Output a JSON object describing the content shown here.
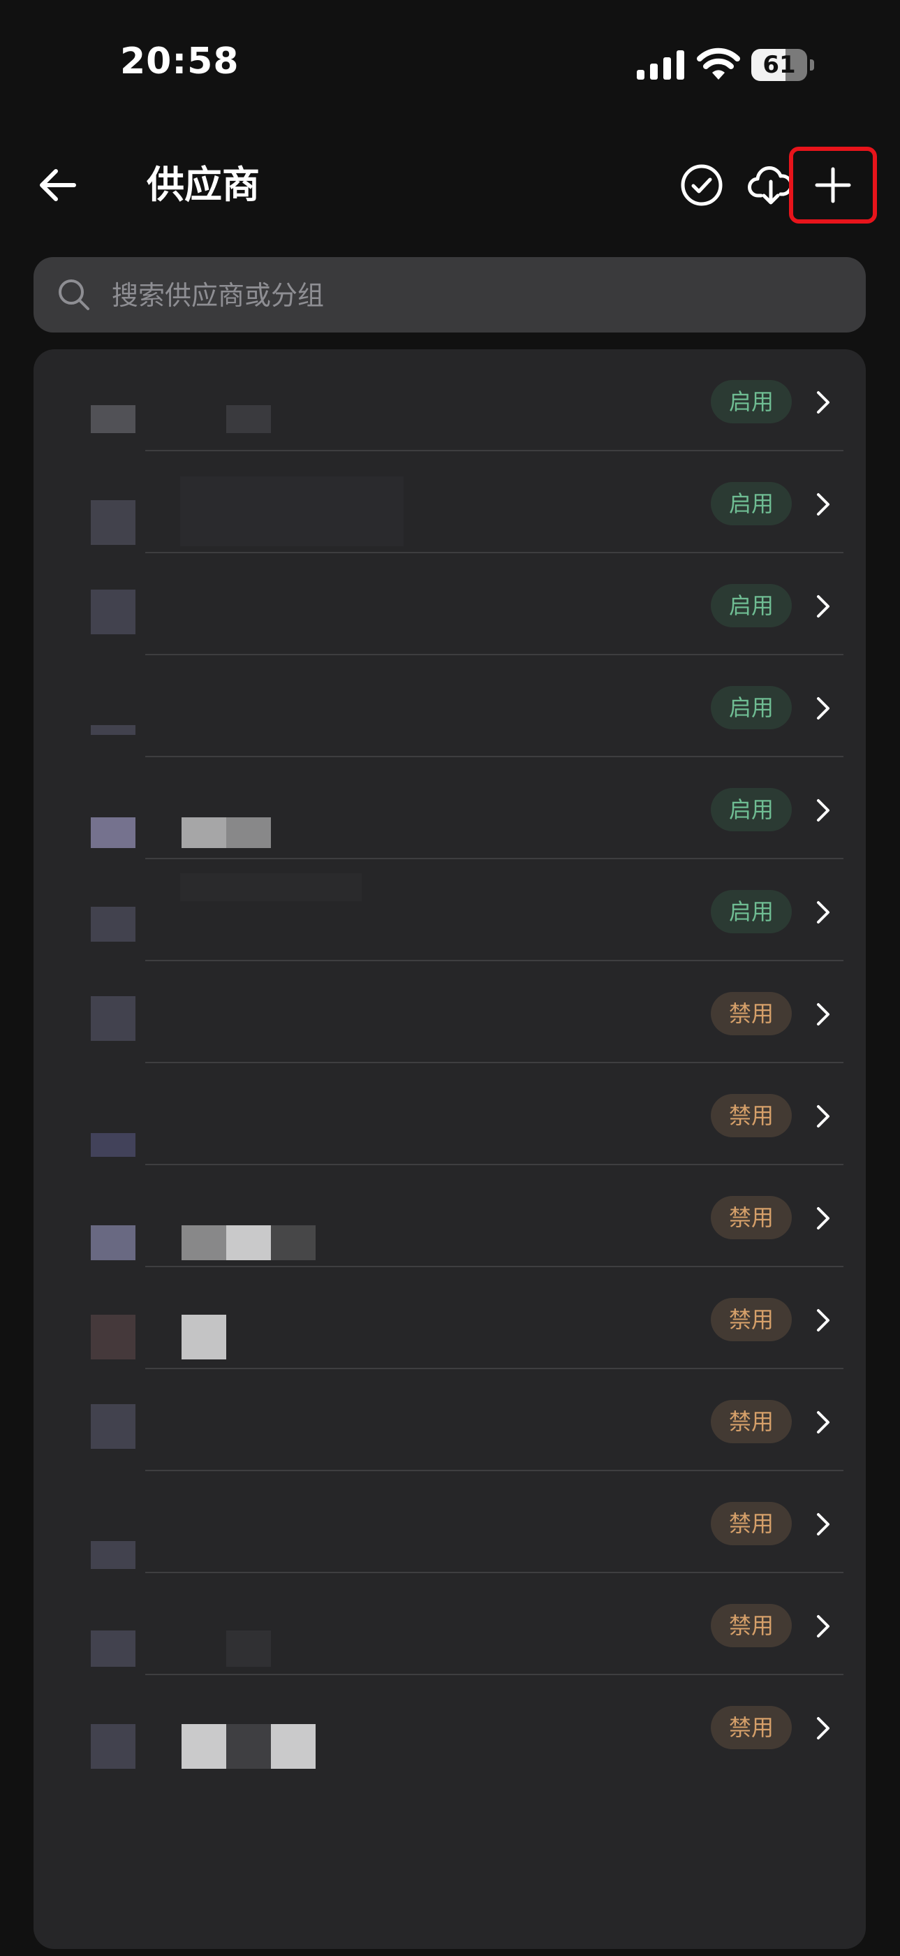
{
  "status_bar": {
    "time": "20:58",
    "battery": "61",
    "icons": [
      "signal-icon",
      "wifi-icon",
      "battery-icon"
    ]
  },
  "nav": {
    "title": "供应商",
    "icons": [
      "arrow-left-icon",
      "check-circle-icon",
      "cloud-download-icon",
      "plus-icon"
    ]
  },
  "search": {
    "placeholder": "搜索供应商或分组"
  },
  "colors": {
    "background": "#111111",
    "card": "#262628",
    "search_bg": "#3a3a3c",
    "enabled_text": "#6fbd93",
    "enabled_bg": "#2b3a33",
    "disabled_text": "#d6a06a",
    "disabled_bg": "#433a33",
    "highlight_box": "#e8141b"
  },
  "providers": [
    {
      "status": "启用",
      "enabled": true
    },
    {
      "status": "启用",
      "enabled": true
    },
    {
      "status": "启用",
      "enabled": true
    },
    {
      "status": "启用",
      "enabled": true
    },
    {
      "status": "启用",
      "enabled": true
    },
    {
      "status": "启用",
      "enabled": true
    },
    {
      "status": "禁用",
      "enabled": false
    },
    {
      "status": "禁用",
      "enabled": false
    },
    {
      "status": "禁用",
      "enabled": false
    },
    {
      "status": "禁用",
      "enabled": false
    },
    {
      "status": "禁用",
      "enabled": false
    },
    {
      "status": "禁用",
      "enabled": false
    },
    {
      "status": "禁用",
      "enabled": false
    },
    {
      "status": "禁用",
      "enabled": false
    }
  ]
}
